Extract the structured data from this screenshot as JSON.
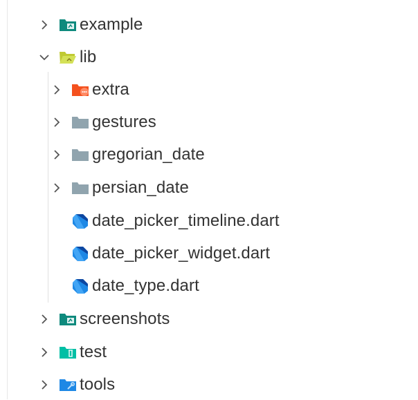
{
  "explorer": {
    "items": [
      {
        "label": "example",
        "icon": "folder-example-icon",
        "expanded": false,
        "color": "#0e8a7d"
      },
      {
        "label": "lib",
        "icon": "folder-lib-open-icon",
        "expanded": true,
        "color": "#b4c43b"
      },
      {
        "label": "extra",
        "icon": "folder-extra-icon",
        "expanded": false,
        "color": "#f4511e"
      },
      {
        "label": "gestures",
        "icon": "folder-icon",
        "expanded": false,
        "color": "#90a4ae"
      },
      {
        "label": "gregorian_date",
        "icon": "folder-icon",
        "expanded": false,
        "color": "#90a4ae"
      },
      {
        "label": "persian_date",
        "icon": "folder-icon",
        "expanded": false,
        "color": "#90a4ae"
      },
      {
        "label": "date_picker_timeline.dart",
        "icon": "dart-file-icon",
        "color": "#1e88e5"
      },
      {
        "label": "date_picker_widget.dart",
        "icon": "dart-file-icon",
        "color": "#1e88e5"
      },
      {
        "label": "date_type.dart",
        "icon": "dart-file-icon",
        "color": "#1e88e5"
      },
      {
        "label": "screenshots",
        "icon": "folder-images-icon",
        "expanded": false,
        "color": "#0e8a7d"
      },
      {
        "label": "test",
        "icon": "folder-test-icon",
        "expanded": false,
        "color": "#00bfa5"
      },
      {
        "label": "tools",
        "icon": "folder-tools-icon",
        "expanded": false,
        "color": "#1e88e5"
      }
    ]
  }
}
